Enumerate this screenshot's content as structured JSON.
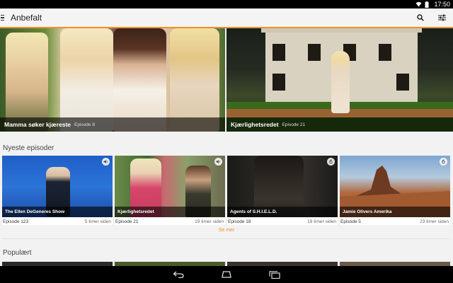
{
  "status_bar": {
    "time": "17:50",
    "icons": [
      "wifi-icon",
      "battery-icon"
    ]
  },
  "app_bar": {
    "title": "Anbefalt",
    "actions": [
      "search-icon",
      "filter-icon"
    ],
    "accent": "#f0902a"
  },
  "featured": [
    {
      "title": "Mamma søker kjæreste",
      "episode": "Episode 8"
    },
    {
      "title": "Kjærlighetsredet",
      "episode": "Episode 21"
    }
  ],
  "newest": {
    "title": "Nyeste episoder",
    "items": [
      {
        "title": "The Ellen DeGeneres Show",
        "episode": "Episode 123",
        "time": "5 timer siden",
        "badge": "sound-icon"
      },
      {
        "title": "Kjærlighetsredet",
        "episode": "Episode 21",
        "time": "19 timer siden",
        "badge": "sound-icon"
      },
      {
        "title": "Agents of S.H.I.E.L.D.",
        "episode": "Episode 18",
        "time": "19 timer siden",
        "badge": "channel-6-icon"
      },
      {
        "title": "Jamie Olivers Amerika",
        "episode": "Episode 5",
        "time": "23 timer siden",
        "badge": "channel-6-icon"
      }
    ],
    "see_more": "Se mer"
  },
  "popular": {
    "title": "Populært"
  },
  "nav_bar": {
    "buttons": [
      "back-icon",
      "home-icon",
      "recents-icon"
    ]
  }
}
